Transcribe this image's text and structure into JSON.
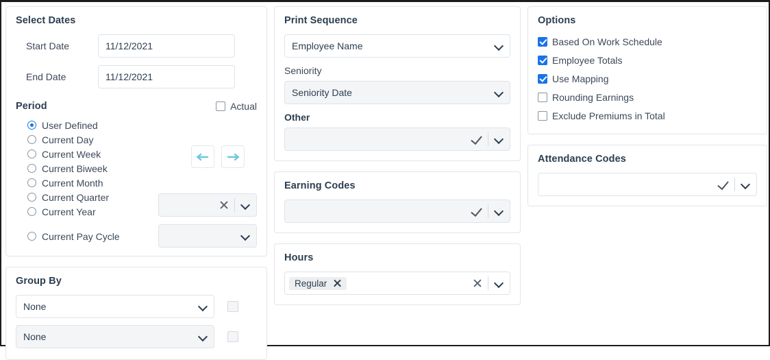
{
  "select_dates": {
    "title": "Select Dates",
    "start_label": "Start Date",
    "start_value": "11/12/2021",
    "end_label": "End Date",
    "end_value": "11/12/2021",
    "period_label": "Period",
    "actual_label": "Actual",
    "actual_checked": false,
    "radios": [
      {
        "label": "User Defined",
        "selected": true
      },
      {
        "label": "Current Day",
        "selected": false
      },
      {
        "label": "Current Week",
        "selected": false
      },
      {
        "label": "Current Biweek",
        "selected": false
      },
      {
        "label": "Current Month",
        "selected": false
      },
      {
        "label": "Current Quarter",
        "selected": false
      },
      {
        "label": "Current Year",
        "selected": false
      },
      {
        "label": "Current Pay Cycle",
        "selected": false
      }
    ],
    "prev_icon": "arrow-left-icon",
    "next_icon": "arrow-right-icon",
    "quarter_value": "",
    "paycycle_value": ""
  },
  "group_by": {
    "title": "Group By",
    "rows": [
      {
        "value": "None",
        "checked": false
      },
      {
        "value": "None",
        "checked": false
      }
    ]
  },
  "print_sequence": {
    "title": "Print Sequence",
    "sequence_value": "Employee Name",
    "seniority_label": "Seniority",
    "seniority_value": "Seniority Date",
    "other_label": "Other",
    "other_value": ""
  },
  "earning_codes": {
    "title": "Earning Codes",
    "value": ""
  },
  "hours": {
    "title": "Hours",
    "chips": [
      "Regular"
    ],
    "value": ""
  },
  "options": {
    "title": "Options",
    "items": [
      {
        "label": "Based On Work Schedule",
        "checked": true
      },
      {
        "label": "Employee Totals",
        "checked": true
      },
      {
        "label": "Use Mapping",
        "checked": true
      },
      {
        "label": "Rounding Earnings",
        "checked": false
      },
      {
        "label": "Exclude Premiums in Total",
        "checked": false
      }
    ]
  },
  "attendance_codes": {
    "title": "Attendance Codes",
    "value": ""
  },
  "colors": {
    "accent": "#1a73e8",
    "arrow": "#6cc8e0",
    "heading": "#2c3e50",
    "field_gray": "#f4f5f7",
    "border": "#e2e5e9"
  }
}
